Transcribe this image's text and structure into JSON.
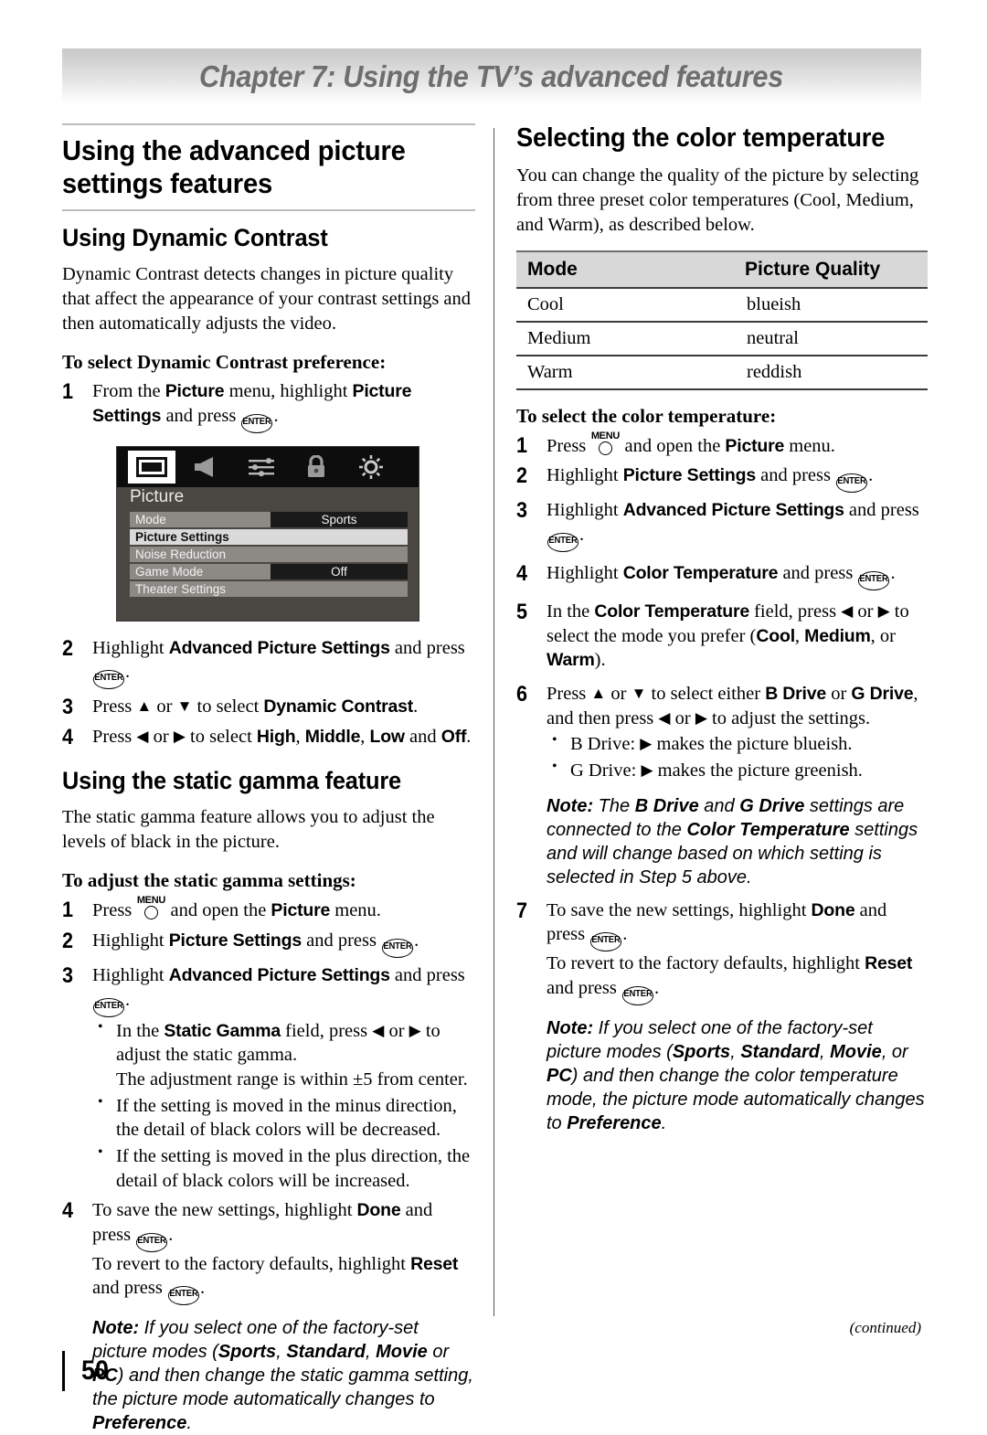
{
  "header": {
    "chapter_title": "Chapter 7: Using the TV’s advanced features"
  },
  "footer": {
    "continued": "(continued)",
    "page_number": "50"
  },
  "glyphs": {
    "enter": "ENTER",
    "menu": "MENU"
  },
  "left_column": {
    "section_title": "Using the advanced picture settings features",
    "dynamic_contrast": {
      "heading": "Using Dynamic Contrast",
      "paragraph": "Dynamic Contrast detects changes in picture quality that affect the appearance of your contrast settings and then automatically adjusts the video.",
      "task_heading": "To select Dynamic Contrast preference:",
      "step1_a": "From the ",
      "step1_picture": "Picture",
      "step1_b": " menu, highlight ",
      "step1_picture_settings": "Picture Settings",
      "step1_c": " and press ",
      "step1_d": ".",
      "step2_a": "Highlight ",
      "step2_adv": "Advanced Picture Settings",
      "step2_b": " and press ",
      "step2_c": ".",
      "step3_a": "Press ",
      "step3_b": " or ",
      "step3_c": " to select ",
      "step3_target": "Dynamic Contrast",
      "step3_d": ".",
      "step4_a": "Press ",
      "step4_b": " or ",
      "step4_c": " to select ",
      "step4_high": "High",
      "step4_sep1": ", ",
      "step4_middle": "Middle",
      "step4_sep2": ", ",
      "step4_low": "Low",
      "step4_and": " and ",
      "step4_off": "Off",
      "step4_d": "."
    },
    "osd": {
      "menu_name": "Picture",
      "icons": [
        "picture-icon",
        "audio-icon",
        "sliders-icon",
        "lock-icon",
        "brightness-icon"
      ],
      "rows": [
        {
          "label": "Mode",
          "value": "Sports",
          "highlighted": false,
          "has_value": true
        },
        {
          "label": "Picture Settings",
          "value": "",
          "highlighted": true,
          "has_value": false
        },
        {
          "label": "Noise Reduction",
          "value": "",
          "highlighted": false,
          "has_value": false
        },
        {
          "label": "Game Mode",
          "value": "Off",
          "highlighted": false,
          "has_value": true
        },
        {
          "label": "Theater Settings",
          "value": "",
          "highlighted": false,
          "has_value": false
        }
      ]
    },
    "static_gamma": {
      "heading": "Using the static gamma feature",
      "paragraph": "The static gamma feature allows you to adjust the levels of black in the picture.",
      "task_heading": "To adjust the static gamma settings:",
      "step1_a": "Press ",
      "step1_b": " and open the ",
      "step1_picture": "Picture",
      "step1_c": " menu.",
      "step2_a": "Highlight ",
      "step2_ps": "Picture Settings",
      "step2_b": " and press ",
      "step2_c": ".",
      "step3_a": "Highlight ",
      "step3_adv": "Advanced Picture Settings",
      "step3_b": " and press ",
      "step3_c": ".",
      "bullet1_a": "In the ",
      "bullet1_field": "Static Gamma",
      "bullet1_b": " field, press ",
      "bullet1_c": " or ",
      "bullet1_d": " to adjust the static gamma.",
      "bullet1_e": "The adjustment range is within ±5 from center.",
      "bullet2": "If the setting is moved in the minus direction, the detail of black colors will be decreased.",
      "bullet3": "If the setting is moved in the plus direction, the detail of black colors will be increased.",
      "step4_a": "To save the new settings, highlight ",
      "step4_done": "Done",
      "step4_b": " and press ",
      "step4_c": ".",
      "step4_d": "To revert to the factory defaults, highlight ",
      "step4_reset": "Reset",
      "step4_e": " and press ",
      "step4_f": ".",
      "note_label": "Note:",
      "note_a": " If you select one of the factory-set picture modes (",
      "note_sports": "Sports",
      "note_s1": ", ",
      "note_standard": "Standard",
      "note_s2": ", ",
      "note_movie": "Movie",
      "note_s3": " or ",
      "note_pc": "PC",
      "note_b": ") and then change the static gamma setting, the picture mode automatically changes to ",
      "note_pref": "Preference",
      "note_c": "."
    }
  },
  "right_column": {
    "color_temp": {
      "heading": "Selecting the color temperature",
      "paragraph": "You can change the quality of the picture by selecting from three preset color temperatures (Cool, Medium, and Warm), as described below.",
      "table": {
        "headers": [
          "Mode",
          "Picture Quality"
        ],
        "rows": [
          [
            "Cool",
            "blueish"
          ],
          [
            "Medium",
            "neutral"
          ],
          [
            "Warm",
            "reddish"
          ]
        ]
      },
      "task_heading": "To select the color temperature:",
      "step1_a": "Press ",
      "step1_b": " and open the ",
      "step1_picture": "Picture",
      "step1_c": " menu.",
      "step2_a": "Highlight ",
      "step2_ps": "Picture Settings",
      "step2_b": " and press ",
      "step2_c": ".",
      "step3_a": "Highlight ",
      "step3_adv": "Advanced Picture Settings",
      "step3_b": " and press ",
      "step3_c": ".",
      "step4_a": "Highlight ",
      "step4_ct": "Color Temperature",
      "step4_b": " and press ",
      "step4_c": ".",
      "step5_a": "In the ",
      "step5_ct": "Color Temperature",
      "step5_b": " field, press ",
      "step5_c": " or ",
      "step5_d": " to select the mode you prefer (",
      "step5_cool": "Cool",
      "step5_s1": ", ",
      "step5_medium": "Medium",
      "step5_s2": ", or ",
      "step5_warm": "Warm",
      "step5_e": ").",
      "step6_a": "Press ",
      "step6_b": " or ",
      "step6_c": " to select either ",
      "step6_bdrive": "B Drive",
      "step6_d": " or ",
      "step6_gdrive": "G Drive",
      "step6_e": ", and then press ",
      "step6_f": " or ",
      "step6_g": " to adjust the settings.",
      "bullet1_a": "B Drive: ",
      "bullet1_b": " makes the picture blueish.",
      "bullet2_a": "G Drive: ",
      "bullet2_b": " makes the picture greenish.",
      "note1_label": "Note:",
      "note1_a": " The ",
      "note1_b": "B Drive",
      "note1_c": " and ",
      "note1_d": "G Drive",
      "note1_e": " settings are connected to the ",
      "note1_f": "Color Temperature",
      "note1_g": " settings and will change based on which setting is selected in Step 5 above.",
      "step7_a": "To save the new settings, highlight ",
      "step7_done": "Done",
      "step7_b": " and press ",
      "step7_c": ".",
      "step7_d": "To revert to the factory defaults, highlight ",
      "step7_reset": "Reset",
      "step7_e": " and press ",
      "step7_f": ".",
      "note2_label": "Note:",
      "note2_a": " If you select one of the factory-set picture modes (",
      "note2_sports": "Sports",
      "note2_s1": ", ",
      "note2_standard": "Standard",
      "note2_s2": ", ",
      "note2_movie": "Movie",
      "note2_s3": ", or ",
      "note2_pc": "PC",
      "note2_b": ") and then change the color temperature mode, the picture mode automatically changes to ",
      "note2_pref": "Preference",
      "note2_c": "."
    }
  }
}
